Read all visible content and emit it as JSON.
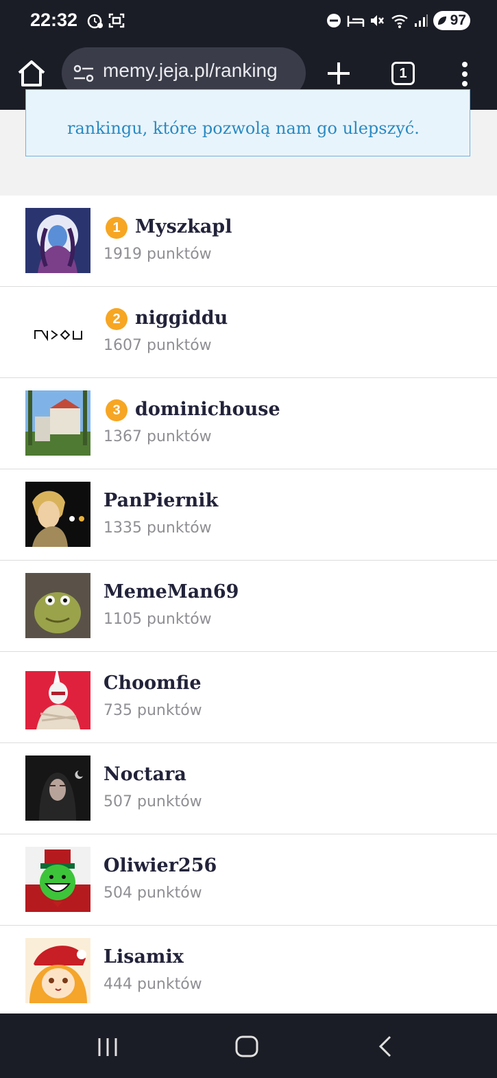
{
  "status_bar": {
    "time": "22:32",
    "battery": "97",
    "icons": [
      "alarm-sync-icon",
      "screenshot-icon",
      "dnd-icon",
      "sleep-mode-icon",
      "mute-icon",
      "wifi-icon",
      "signal-icon",
      "battery-icon"
    ]
  },
  "browser": {
    "url": "memy.jeja.pl/ranking",
    "tab_count": "1"
  },
  "notice": {
    "text": "rankingu, które pozwolą nam go ulepszyć."
  },
  "ranking": [
    {
      "rank": "1",
      "name": "Myszkapl",
      "points": "1919 punktów"
    },
    {
      "rank": "2",
      "name": "niggiddu",
      "points": "1607 punktów"
    },
    {
      "rank": "3",
      "name": "dominichouse",
      "points": "1367 punktów"
    },
    {
      "rank": "",
      "name": "PanPiernik",
      "points": "1335 punktów"
    },
    {
      "rank": "",
      "name": "MemeMan69",
      "points": "1105 punktów"
    },
    {
      "rank": "",
      "name": "Choomfie",
      "points": "735 punktów"
    },
    {
      "rank": "",
      "name": "Noctara",
      "points": "507 punktów"
    },
    {
      "rank": "",
      "name": "Oliwier256",
      "points": "504 punktów"
    },
    {
      "rank": "",
      "name": "Lisamix",
      "points": "444 punktów"
    }
  ],
  "colors": {
    "accent": "#f6a623",
    "link": "#2a8ac2",
    "chrome_bg": "#1b1d26"
  }
}
